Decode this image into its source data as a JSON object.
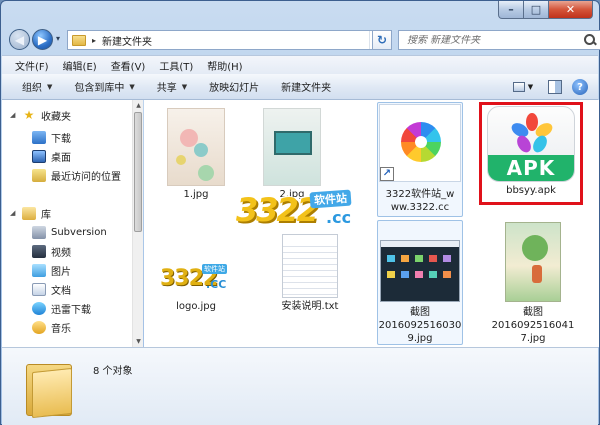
{
  "window": {
    "caption": {
      "minimize": "–",
      "maximize": "□",
      "close": "✕"
    }
  },
  "nav": {
    "back": "◀",
    "forward": "▶",
    "history": "▾",
    "address_path": "新建文件夹",
    "address_sep": "▸",
    "address_drop": "▾",
    "refresh": "↻",
    "search_placeholder": "搜索 新建文件夹"
  },
  "menu": [
    "文件(F)",
    "编辑(E)",
    "查看(V)",
    "工具(T)",
    "帮助(H)"
  ],
  "toolbar": {
    "organize": "组织",
    "include": "包含到库中",
    "share": "共享",
    "slideshow": "放映幻灯片",
    "new_folder": "新建文件夹",
    "arrow": "▼",
    "help": "?"
  },
  "sidebar": {
    "favorites": "收藏夹",
    "downloads": "下载",
    "desktop": "桌面",
    "recent": "最近访问的位置",
    "libraries": "库",
    "lib_items": [
      "Subversion",
      "视频",
      "图片",
      "文档",
      "迅雷下载",
      "音乐"
    ]
  },
  "files": [
    {
      "name": "1.jpg"
    },
    {
      "name": "2.jpg"
    },
    {
      "name": "3322软件站_www.3322.cc"
    },
    {
      "name": "bbsyy.apk",
      "thumb_text": "APK"
    },
    {
      "name": "logo.jpg",
      "logo_main": "3322",
      "logo_soft": "软件站",
      "logo_cc": ".CC"
    },
    {
      "name": "安装说明.txt"
    },
    {
      "name": "截图2016092516030 9.jpg",
      "lines": [
        "截图",
        "2016092516030",
        "9.jpg"
      ]
    },
    {
      "name": "截图2016092516041 7.jpg",
      "lines": [
        "截图",
        "2016092516041",
        "7.jpg"
      ]
    }
  ],
  "watermark": {
    "main": "3322",
    "soft": "软件站",
    "cc": ".cc"
  },
  "details": {
    "count": "8 个对象"
  },
  "colors": {
    "selection_border": "#e0111a",
    "apk_band": "#21b36b"
  }
}
